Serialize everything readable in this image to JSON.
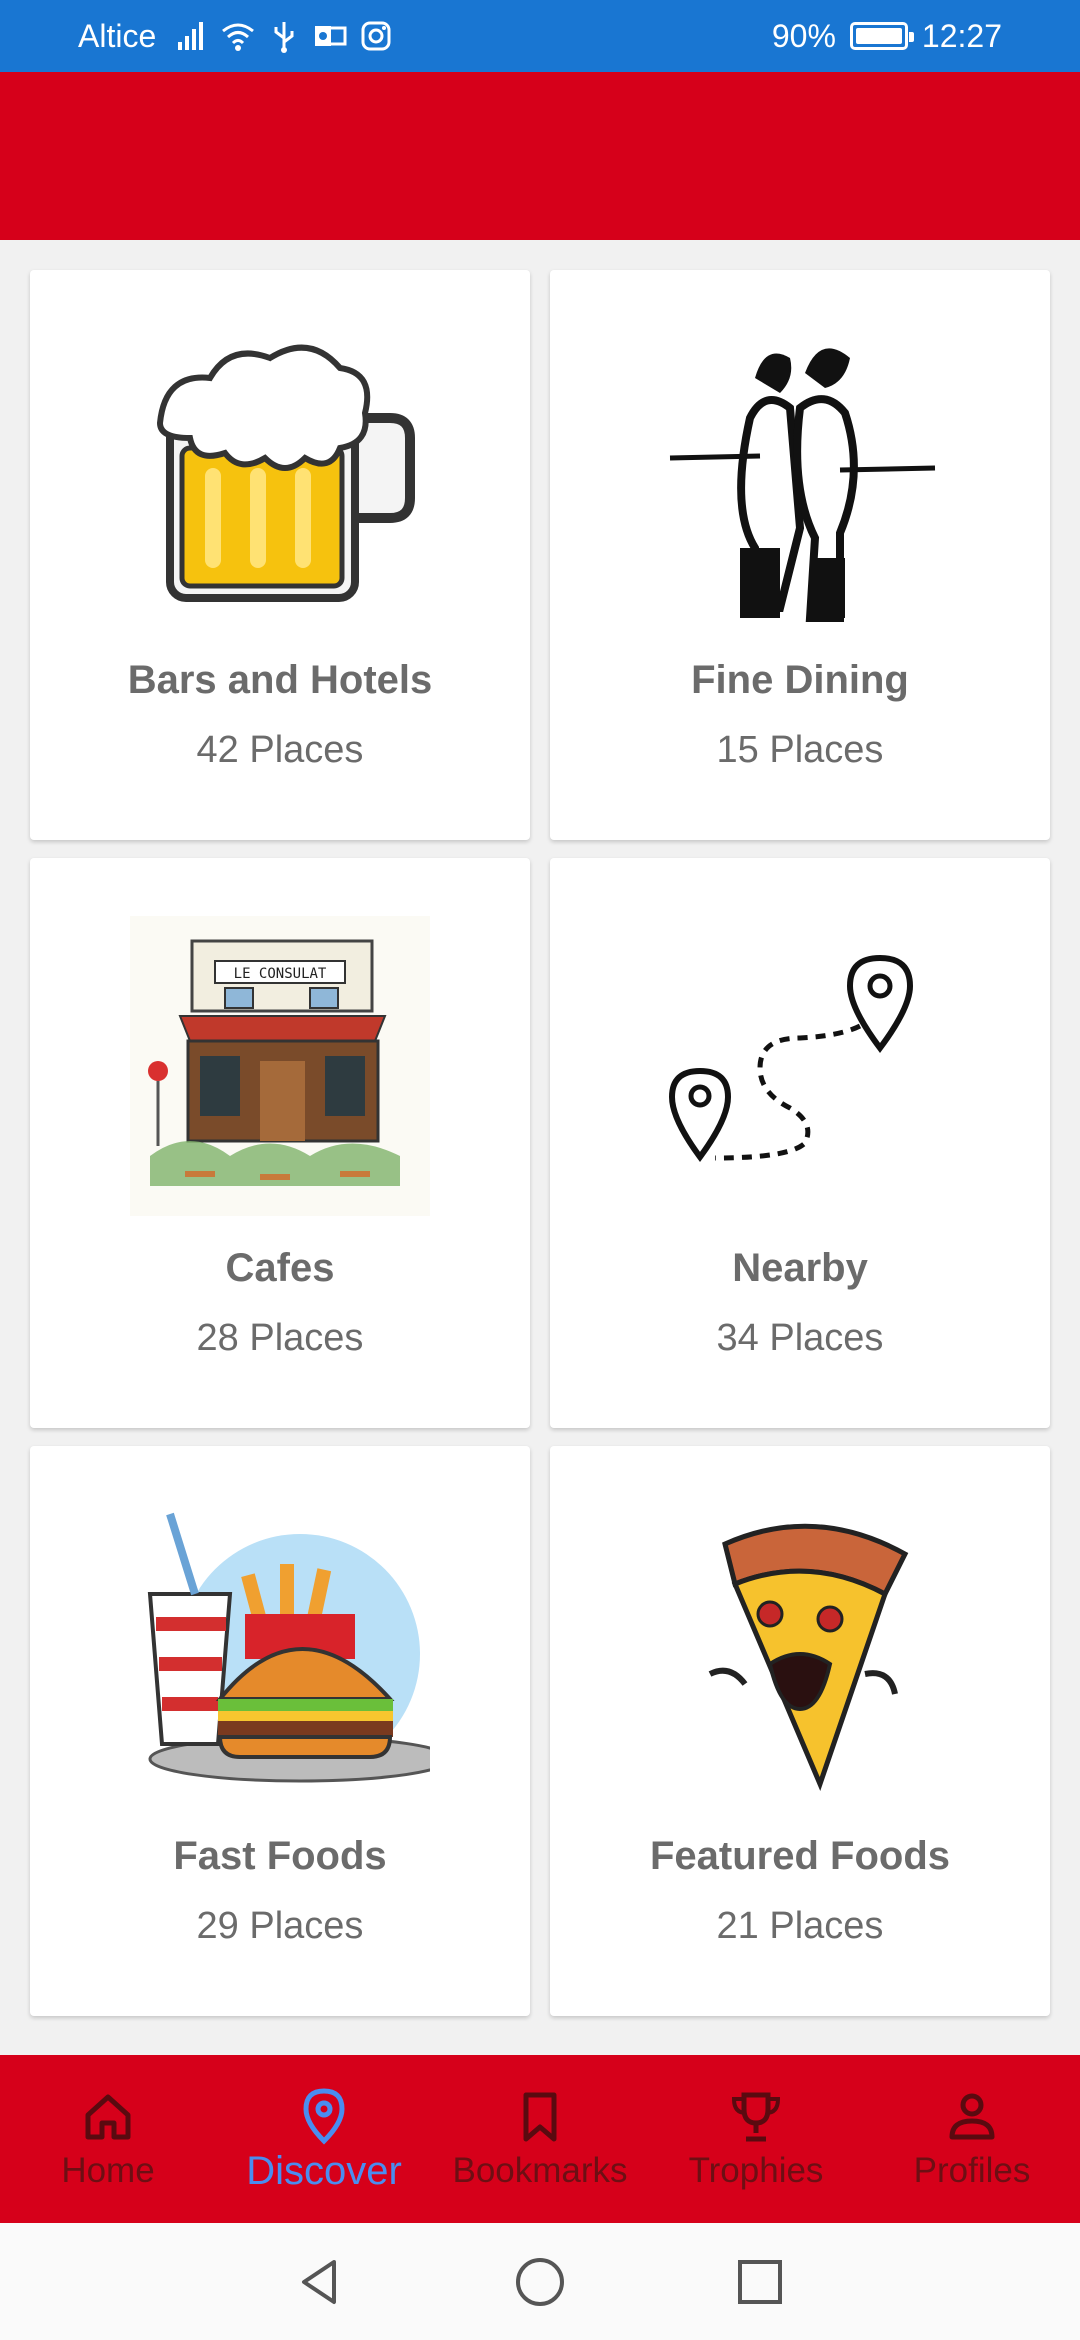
{
  "status_bar": {
    "carrier": "Altice",
    "battery": "90%",
    "time": "12:27"
  },
  "categories": [
    {
      "title": "Bars and Hotels",
      "count": "42 Places",
      "icon": "beer-mug-icon"
    },
    {
      "title": "Fine Dining",
      "count": "15 Places",
      "icon": "waiters-icon"
    },
    {
      "title": "Cafes",
      "count": "28 Places",
      "icon": "cafe-building-icon"
    },
    {
      "title": "Nearby",
      "count": "34 Places",
      "icon": "map-route-icon"
    },
    {
      "title": "Fast Foods",
      "count": "29 Places",
      "icon": "burger-fries-icon"
    },
    {
      "title": "Featured Foods",
      "count": "21 Places",
      "icon": "pizza-monster-icon"
    }
  ],
  "cafe_sign": "LE CONSULAT",
  "bottom_nav": [
    {
      "label": "Home",
      "icon": "home-icon",
      "active": false
    },
    {
      "label": "Discover",
      "icon": "location-pin-icon",
      "active": true
    },
    {
      "label": "Bookmarks",
      "icon": "bookmark-icon",
      "active": false
    },
    {
      "label": "Trophies",
      "icon": "trophy-icon",
      "active": false
    },
    {
      "label": "Profiles",
      "icon": "person-icon",
      "active": false
    }
  ],
  "colors": {
    "status_bar": "#1976d2",
    "brand_red": "#d6001a",
    "active_nav": "#4a8df0",
    "card_text": "#6b6b6b"
  }
}
